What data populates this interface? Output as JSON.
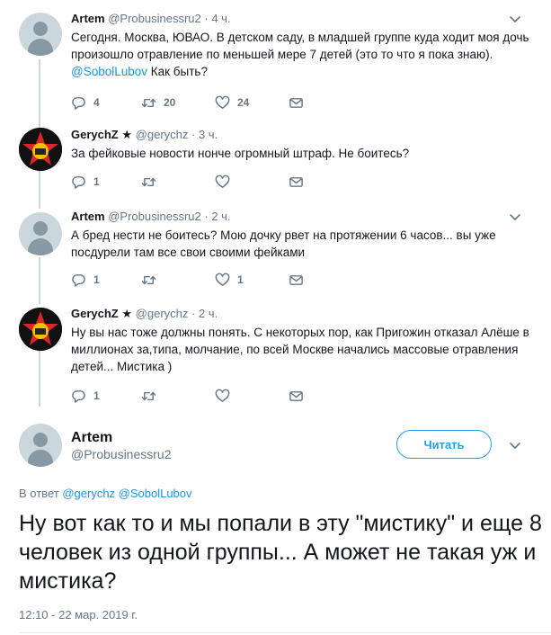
{
  "tweets": [
    {
      "name": "Artem",
      "handle": "@Probusinessru2",
      "time": "4 ч.",
      "text_pre": "Сегодня. Москва, ЮВАО. В детском саду, в младшей группе куда ходит моя дочь произошло отравление по меньшей мере 7 детей (это то что я пока знаю). ",
      "mention": "@SobolLubov",
      "text_post": " Как быть?",
      "replies": "4",
      "retweets": "20",
      "likes": "24"
    },
    {
      "name": "GerychZ",
      "star": "★",
      "handle": "@gerychz",
      "time": "3 ч.",
      "text": "За фейковые новости нонче огромный штраф. Не боитесь?",
      "replies": "1",
      "retweets": "",
      "likes": ""
    },
    {
      "name": "Artem",
      "handle": "@Probusinessru2",
      "time": "2 ч.",
      "text": "А бред нести не боитесь? Мою дочку рвет на протяжении 6 часов... вы уже посдурели там все свои своими фейками",
      "replies": "1",
      "retweets": "",
      "likes": "1"
    },
    {
      "name": "GerychZ",
      "star": "★",
      "handle": "@gerychz",
      "time": "2 ч.",
      "text": "Ну вы нас тоже должны понять. С некоторых пор, как Пригожин отказал Алёше в миллионах за,типа, молчание, по всей Москве начались массовые отравления детей... Мистика )",
      "replies": "1",
      "retweets": "",
      "likes": ""
    }
  ],
  "main": {
    "name": "Artem",
    "handle": "@Probusinessru2",
    "follow_label": "Читать",
    "reply_prefix": "В ответ",
    "reply_mentions": "@gerychz @SobolLubov",
    "text": "Ну вот как то и мы попали в эту \"мистику\" и еще 8 человек из одной группы... А может не такая уж и мистика?",
    "timestamp": "12:10 - 22 мар. 2019 г."
  },
  "colors": {
    "accent": "#1da1f2",
    "mention": "#1b95e0",
    "muted": "#657786",
    "thread_line": "#ccd6dd"
  },
  "icons": [
    "reply-icon",
    "retweet-icon",
    "like-icon",
    "message-icon",
    "chevron-down-icon",
    "default-avatar-icon"
  ]
}
